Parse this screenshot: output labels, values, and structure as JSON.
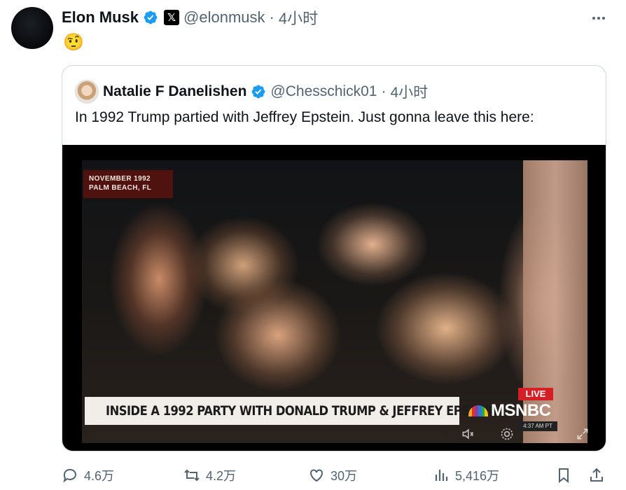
{
  "author": {
    "name": "Elon Musk",
    "handle": "@elonmusk",
    "separator": "·",
    "time": "4小时",
    "x_badge": "𝕏"
  },
  "post": {
    "emoji": "🤨"
  },
  "quoted": {
    "name": "Natalie F Danelishen",
    "handle": "@Chesschick01",
    "separator": "·",
    "time": "4小时",
    "text": "In 1992 Trump partied with Jeffrey Epstein. Just gonna leave this here:",
    "video": {
      "badge_line1": "NOVEMBER 1992",
      "badge_line2": "PALM BEACH, FL",
      "chyron": "INSIDE A 1992 PARTY WITH DONALD TRUMP & JEFFREY EPSTEIN",
      "network": "MSNBC",
      "live": "LIVE",
      "clock": "4:37 AM PT"
    }
  },
  "actions": {
    "replies": "4.6万",
    "reposts": "4.2万",
    "likes": "30万",
    "views": "5,416万"
  },
  "colors": {
    "verified": "#1d9bf0",
    "secondary_text": "#536471",
    "border": "#cfd9de"
  },
  "icons": [
    "more-icon",
    "verified-icon",
    "x-logo-icon",
    "reply-icon",
    "repost-icon",
    "like-icon",
    "views-icon",
    "bookmark-icon",
    "share-icon",
    "settings-icon",
    "fullscreen-icon",
    "volume-icon"
  ]
}
